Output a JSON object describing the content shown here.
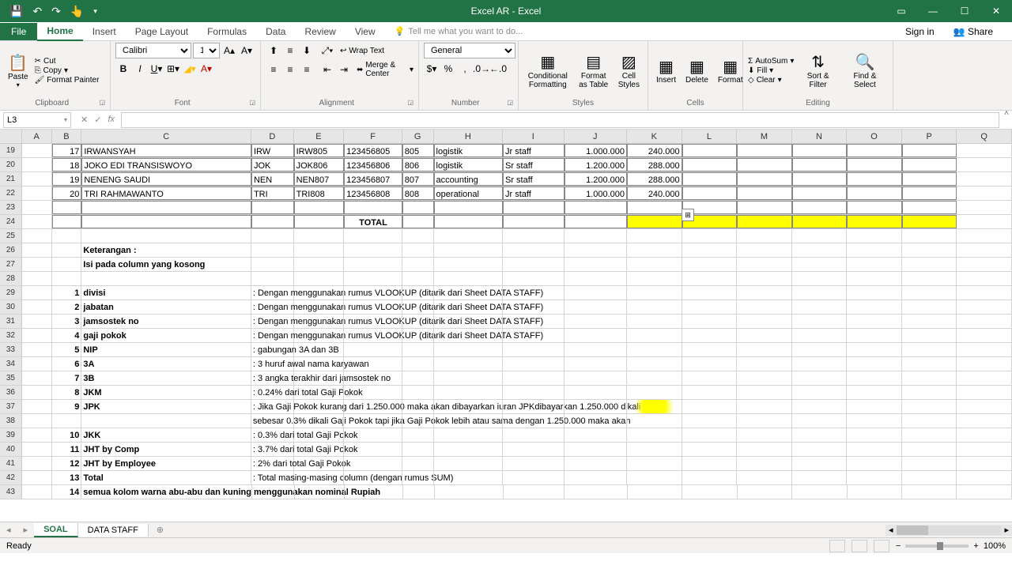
{
  "app": {
    "title": "Excel AR - Excel"
  },
  "tabs": {
    "file": "File",
    "home": "Home",
    "insert": "Insert",
    "pagelayout": "Page Layout",
    "formulas": "Formulas",
    "data": "Data",
    "review": "Review",
    "view": "View",
    "tellme": "Tell me what you want to do...",
    "signin": "Sign in",
    "share": "Share"
  },
  "ribbon": {
    "clipboard": {
      "paste": "Paste",
      "cut": "Cut",
      "copy": "Copy",
      "formatpainter": "Format Painter",
      "label": "Clipboard"
    },
    "font": {
      "name": "Calibri",
      "size": "11",
      "label": "Font"
    },
    "alignment": {
      "wraptext": "Wrap Text",
      "merge": "Merge & Center",
      "label": "Alignment"
    },
    "number": {
      "format": "General",
      "label": "Number"
    },
    "styles": {
      "cond": "Conditional Formatting",
      "fat": "Format as Table",
      "cellstyles": "Cell Styles",
      "label": "Styles"
    },
    "cells": {
      "insert": "Insert",
      "delete": "Delete",
      "format": "Format",
      "label": "Cells"
    },
    "editing": {
      "autosum": "AutoSum",
      "fill": "Fill",
      "clear": "Clear",
      "sort": "Sort & Filter",
      "find": "Find & Select",
      "label": "Editing"
    }
  },
  "namebox": "L3",
  "cols": [
    "A",
    "B",
    "C",
    "D",
    "E",
    "F",
    "G",
    "H",
    "I",
    "J",
    "K",
    "L",
    "M",
    "N",
    "O",
    "P",
    "Q"
  ],
  "rows": [
    {
      "n": 19,
      "cells": {
        "B": "17",
        "C": "IRWANSYAH",
        "D": "IRW",
        "E": "IRW805",
        "F": "123456805",
        "G": "805",
        "H": "logistik",
        "I": "Jr staff",
        "J": "1.000.000",
        "K": "240.000"
      },
      "bordered": true
    },
    {
      "n": 20,
      "cells": {
        "B": "18",
        "C": "JOKO EDI TRANSISWOYO",
        "D": "JOK",
        "E": "JOK806",
        "F": "123456806",
        "G": "806",
        "H": "logistik",
        "I": "Sr staff",
        "J": "1.200.000",
        "K": "288.000"
      },
      "bordered": true
    },
    {
      "n": 21,
      "cells": {
        "B": "19",
        "C": "NENENG SAUDI",
        "D": "NEN",
        "E": "NEN807",
        "F": "123456807",
        "G": "807",
        "H": "accounting",
        "I": "Sr staff",
        "J": "1.200.000",
        "K": "288.000"
      },
      "bordered": true
    },
    {
      "n": 22,
      "cells": {
        "B": "20",
        "C": "TRI RAHMAWANTO",
        "D": "TRI",
        "E": "TRI808",
        "F": "123456808",
        "G": "808",
        "H": "operational",
        "I": "Jr staff",
        "J": "1.000.000",
        "K": "240.000"
      },
      "bordered": true
    },
    {
      "n": 23,
      "cells": {},
      "bordered": true,
      "blankrow": true
    },
    {
      "n": 24,
      "cells": {
        "F": "TOTAL"
      },
      "total": true
    },
    {
      "n": 25,
      "cells": {}
    },
    {
      "n": 26,
      "cells": {
        "C": "Keterangan :"
      },
      "bold": true
    },
    {
      "n": 27,
      "cells": {
        "C": "Isi pada column yang kosong"
      },
      "bold": true
    },
    {
      "n": 28,
      "cells": {}
    },
    {
      "n": 29,
      "cells": {
        "B": "1",
        "C": "divisi",
        "D": ": Dengan menggunakan rumus VLOOKUP (ditarik dari Sheet DATA STAFF)"
      },
      "bold": true
    },
    {
      "n": 30,
      "cells": {
        "B": "2",
        "C": "jabatan",
        "D": ": Dengan menggunakan rumus VLOOKUP (ditarik dari Sheet DATA STAFF)"
      },
      "bold": true
    },
    {
      "n": 31,
      "cells": {
        "B": "3",
        "C": "jamsostek no",
        "D": ": Dengan menggunakan rumus VLOOKUP (ditarik dari Sheet DATA STAFF)"
      },
      "bold": true
    },
    {
      "n": 32,
      "cells": {
        "B": "4",
        "C": "gaji pokok",
        "D": ": Dengan menggunakan rumus VLOOKUP (ditarik dari Sheet DATA STAFF)"
      },
      "bold": true
    },
    {
      "n": 33,
      "cells": {
        "B": "5",
        "C": "NIP",
        "D": ": gabungan 3A dan 3B"
      },
      "bold": true
    },
    {
      "n": 34,
      "cells": {
        "B": "6",
        "C": "3A",
        "D": ": 3 huruf awal nama karyawan"
      },
      "bold": true
    },
    {
      "n": 35,
      "cells": {
        "B": "7",
        "C": "3B",
        "D": ": 3 angka terakhir dari jamsostek no"
      },
      "bold": true
    },
    {
      "n": 36,
      "cells": {
        "B": "8",
        "C": "JKM",
        "D": ": 0.24% dari total Gaji Pokok"
      },
      "bold": true
    },
    {
      "n": 37,
      "cells": {
        "B": "9",
        "C": "JPK",
        "D": ": Jika Gaji Pokok kurang dari 1.250.000 maka akan dibayarkan iuran JPKdibayarkan 1.250.000 dikali 0.3%"
      },
      "bold": true
    },
    {
      "n": 38,
      "cells": {
        "D": "   sebesar 0.3% dikali Gaji Pokok tapi jika Gaji Pokok lebih atau sama dengan 1.250.000 maka akan"
      }
    },
    {
      "n": 39,
      "cells": {
        "B": "10",
        "C": "JKK",
        "D": ": 0.3% dari total Gaji Pokok"
      },
      "bold": true
    },
    {
      "n": 40,
      "cells": {
        "B": "11",
        "C": "JHT by Comp",
        "D": ": 3.7% dari total Gaji Pokok"
      },
      "bold": true
    },
    {
      "n": 41,
      "cells": {
        "B": "12",
        "C": "JHT by Employee",
        "D": ": 2% dari total Gaji Pokok"
      },
      "bold": true
    },
    {
      "n": 42,
      "cells": {
        "B": "13",
        "C": "Total",
        "D": ": Total masing-masing column (dengan rumus SUM)"
      },
      "bold": true
    },
    {
      "n": 43,
      "cells": {
        "B": "14",
        "C": "semua kolom warna abu-abu dan kuning menggunakan nominal Rupiah"
      },
      "bold": true
    }
  ],
  "sheets": {
    "active": "SOAL",
    "other": "DATA STAFF"
  },
  "status": {
    "ready": "Ready",
    "zoom": "100%"
  }
}
